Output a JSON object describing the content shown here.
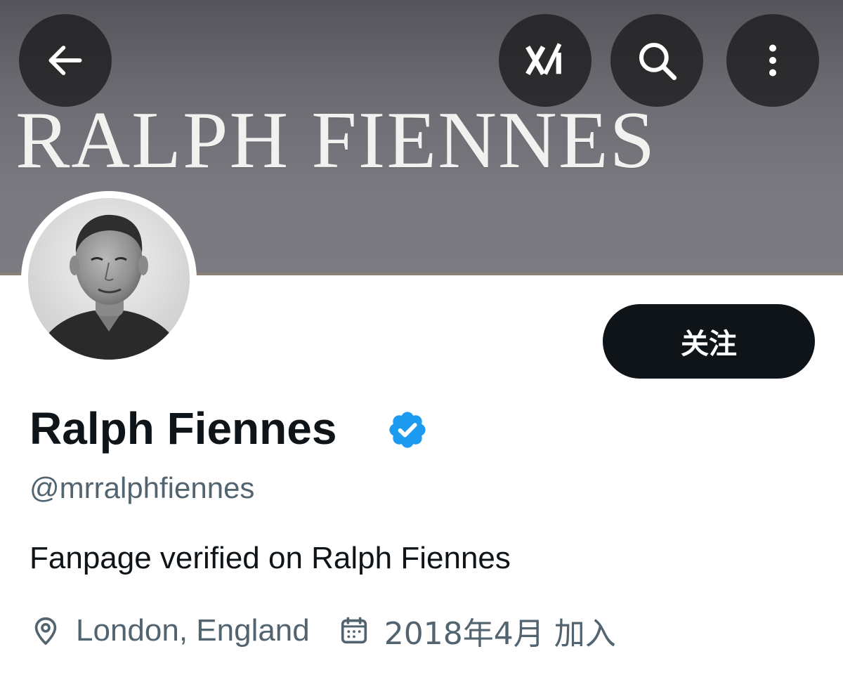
{
  "header": {
    "banner_text": "RALPH FIENNES",
    "back_icon": "arrow-left-icon",
    "grok_icon": "xai-grok-icon",
    "search_icon": "search-icon",
    "more_icon": "more-vertical-icon"
  },
  "profile": {
    "display_name": "Ralph Fiennes",
    "verified_icon": "verified-badge-icon",
    "handle": "@mrralphfiennes",
    "bio": "Fanpage verified on Ralph Fiennes",
    "location": "London, England",
    "location_icon": "location-pin-icon",
    "joined": "2018年4月 加入",
    "joined_icon": "calendar-icon",
    "follow_label": "关注"
  },
  "colors": {
    "follow_bg": "#0f1419",
    "verified_blue": "#1d9bf0",
    "secondary_text": "#536471"
  }
}
